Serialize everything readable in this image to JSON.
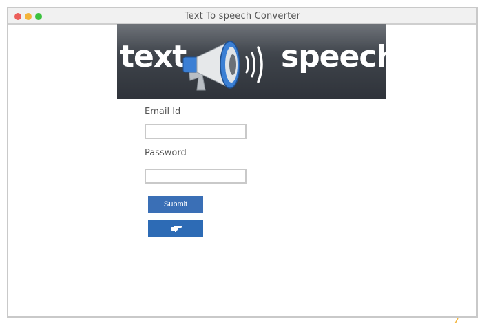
{
  "window": {
    "title": "Text To speech Converter"
  },
  "banner": {
    "word_left": "text",
    "word_right": "speech",
    "logo_icon": "megaphone-icon"
  },
  "form": {
    "email_label": "Email Id",
    "email_value": "",
    "password_label": "Password",
    "password_value": "",
    "submit_label": "Submit",
    "secondary_icon": "pointing-hand-icon"
  },
  "colors": {
    "button_primary": "#3a6fb6",
    "button_secondary": "#2d6bb5",
    "banner_dark": "#2f333a",
    "megaphone_blue": "#3b7fd4"
  }
}
